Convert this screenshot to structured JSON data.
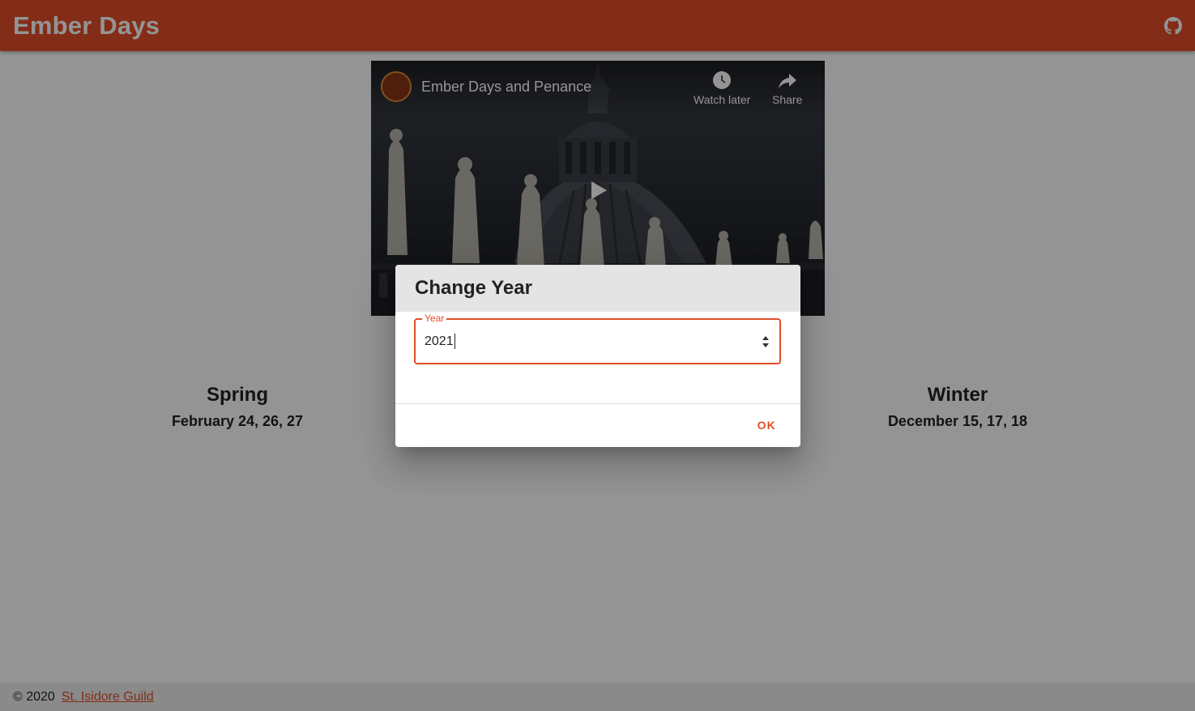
{
  "app": {
    "title": "Ember Days"
  },
  "video": {
    "title": "Ember Days and Penance",
    "watch_later_label": "Watch later",
    "share_label": "Share"
  },
  "seasons": [
    {
      "name": "Spring",
      "dates": "February 24, 26, 27"
    },
    {
      "name": "Winter",
      "dates": "December 15, 17, 18"
    }
  ],
  "footer": {
    "copyright": "© 2020",
    "link_label": "St. Isidore Guild"
  },
  "dialog": {
    "title": "Change Year",
    "field_label": "Year",
    "field_value": "2021",
    "ok_label": "OK"
  },
  "colors": {
    "accent": "#e24e2a",
    "header_gray": "#e4e4e4"
  }
}
